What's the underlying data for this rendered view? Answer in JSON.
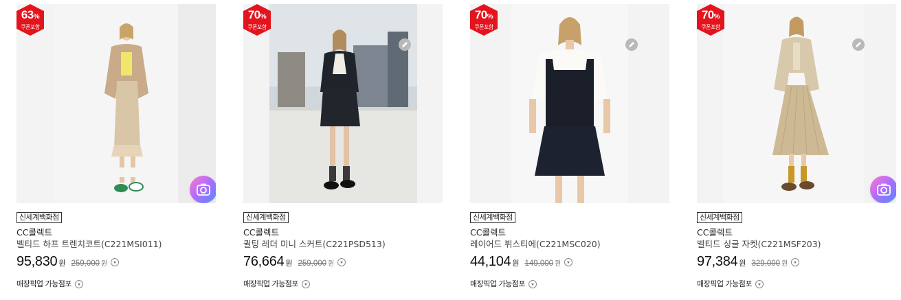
{
  "products": [
    {
      "discount": "63",
      "discount_unit": "%",
      "coupon_label": "쿠폰포함",
      "store": "신세계백화점",
      "brand": "CC콜렉트",
      "name": "벨티드 하프 트렌치코트(C221MSI011)",
      "price": "95,830",
      "currency": "원",
      "original_price": "259,000",
      "pickup": "매장픽업 가능점포",
      "has_camera": true,
      "has_edit": false
    },
    {
      "discount": "70",
      "discount_unit": "%",
      "coupon_label": "쿠폰포함",
      "store": "신세계백화점",
      "brand": "CC콜렉트",
      "name": "퀼팅 레더 미니 스커트(C221PSD513)",
      "price": "76,664",
      "currency": "원",
      "original_price": "259,000",
      "pickup": "매장픽업 가능점포",
      "has_camera": false,
      "has_edit": true
    },
    {
      "discount": "70",
      "discount_unit": "%",
      "coupon_label": "쿠폰포함",
      "store": "신세계백화점",
      "brand": "CC콜렉트",
      "name": "레이어드 뷔스티에(C221MSC020)",
      "price": "44,104",
      "currency": "원",
      "original_price": "149,000",
      "pickup": "매장픽업 가능점포",
      "has_camera": false,
      "has_edit": true
    },
    {
      "discount": "70",
      "discount_unit": "%",
      "coupon_label": "쿠폰포함",
      "store": "신세계백화점",
      "brand": "CC콜렉트",
      "name": "벨티드 싱글 자켓(C221MSF203)",
      "price": "97,384",
      "currency": "원",
      "original_price": "329,000",
      "pickup": "매장픽업 가능점포",
      "has_camera": true,
      "has_edit": true
    }
  ],
  "icons": {
    "badge": "discount-hexagon-icon",
    "edit": "pencil-icon",
    "camera": "camera-icon",
    "info": "chevron-down-circle-icon"
  },
  "colors": {
    "badge": "#e3141d",
    "camera_gradient_start": "#ff7ac4",
    "camera_gradient_end": "#4e8dff"
  }
}
